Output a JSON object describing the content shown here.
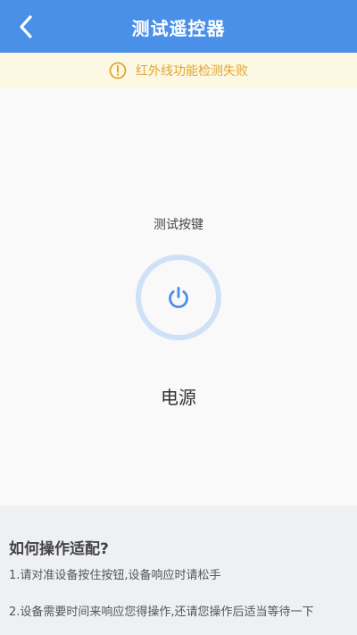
{
  "header": {
    "title": "测试遥控器",
    "back_icon": "chevron-left-icon",
    "background_color": "#4a90e8"
  },
  "warning": {
    "icon": "warning-circle-icon",
    "text": "红外线功能检测失败",
    "color": "#e0a72e"
  },
  "test": {
    "label": "测试按键",
    "button_icon": "power-icon",
    "button_label": "电源",
    "accent_color": "#4a90e8"
  },
  "help": {
    "title": "如何操作适配?",
    "steps": [
      "1.请对准设备按住按钮,设备响应时请松手",
      "2.设备需要时间来响应您得操作,还请您操作后适当等待一下"
    ]
  }
}
